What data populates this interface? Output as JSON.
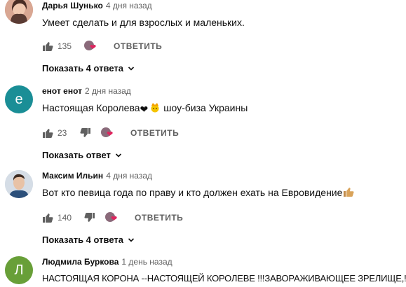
{
  "comments": [
    {
      "author": "Дарья Шунько",
      "time": "4 дня назад",
      "text": "Умеет сделать и для взрослых и маленьких.",
      "likes": "135",
      "reply_label": "ОТВЕТИТЬ",
      "show_replies": "Показать 4 ответа"
    },
    {
      "author": "енот енот",
      "time": "2 дня назад",
      "avatar_letter": "е",
      "text_before": "Настоящая Королева",
      "text_after": "шоу-биза Украины",
      "likes": "23",
      "reply_label": "ОТВЕТИТЬ",
      "show_replies": "Показать ответ"
    },
    {
      "author": "Максим Ильин",
      "time": "4 дня назад",
      "text": "Вот кто певица года по праву и кто должен ехать на Евровидение",
      "likes": "140",
      "reply_label": "ОТВЕТИТЬ",
      "show_replies": "Показать 4 ответа"
    },
    {
      "author": "Людмила Буркова",
      "time": "1 день назад",
      "avatar_letter": "Л",
      "text": "НАСТОЯЩАЯ КОРОНА --НАСТОЯЩЕЙ КОРОЛЕВЕ !!!ЗАВОРАЖИВАЮЩЕЕ  ЗРЕЛИЩЕ,!"
    }
  ],
  "colors": {
    "avatar_e": "#1a8e96",
    "avatar_l": "#689f38",
    "heart": "#e0245e",
    "secondary_text": "#606060"
  },
  "icons": [
    "thumbs-up-icon",
    "thumbs-down-icon",
    "creator-heart-icon",
    "chevron-down-icon",
    "black-heart-emoji",
    "crown-emoji",
    "thumbs-up-emoji"
  ]
}
